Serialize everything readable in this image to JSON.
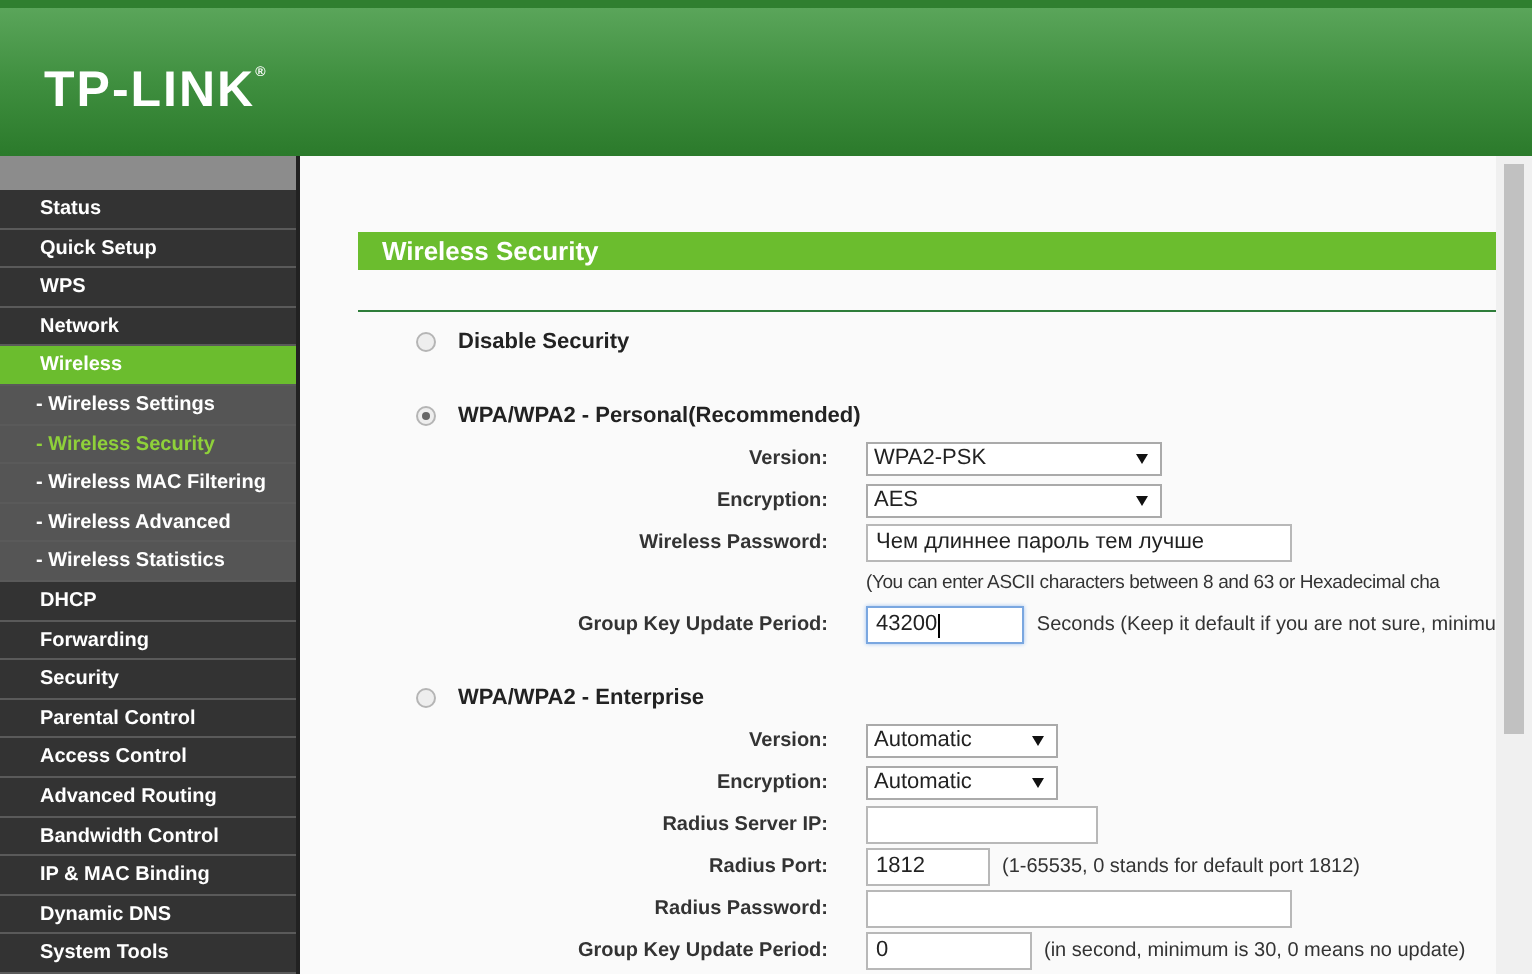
{
  "header": {
    "logo": "TP-LINK",
    "logo_mark": "®"
  },
  "sidebar": {
    "items": [
      {
        "label": "Status",
        "selected": false
      },
      {
        "label": "Quick Setup",
        "selected": false
      },
      {
        "label": "WPS",
        "selected": false
      },
      {
        "label": "Network",
        "selected": false
      },
      {
        "label": "Wireless",
        "selected": true,
        "children": [
          {
            "label": "- Wireless Settings",
            "selected": false
          },
          {
            "label": "- Wireless Security",
            "selected": true
          },
          {
            "label": "- Wireless MAC Filtering",
            "selected": false
          },
          {
            "label": "- Wireless Advanced",
            "selected": false
          },
          {
            "label": "- Wireless Statistics",
            "selected": false
          }
        ]
      },
      {
        "label": "DHCP",
        "selected": false
      },
      {
        "label": "Forwarding",
        "selected": false
      },
      {
        "label": "Security",
        "selected": false
      },
      {
        "label": "Parental Control",
        "selected": false
      },
      {
        "label": "Access Control",
        "selected": false
      },
      {
        "label": "Advanced Routing",
        "selected": false
      },
      {
        "label": "Bandwidth Control",
        "selected": false
      },
      {
        "label": "IP & MAC Binding",
        "selected": false
      },
      {
        "label": "Dynamic DNS",
        "selected": false
      },
      {
        "label": "System Tools",
        "selected": false
      }
    ]
  },
  "page_title": "Wireless Security",
  "sections": [
    {
      "label": "Disable Security",
      "selected": false
    },
    {
      "label": "WPA/WPA2 - Personal(Recommended)",
      "selected": true,
      "fields": [
        {
          "kind": "select",
          "label": "Version:",
          "value": "WPA2-PSK"
        },
        {
          "kind": "select",
          "label": "Encryption:",
          "value": "AES"
        },
        {
          "kind": "input",
          "label": "Wireless Password:",
          "value": "Чем длиннее пароль тем лучше",
          "focused": false
        },
        {
          "kind": "hint",
          "text": "(You can enter ASCII characters between 8 and 63 or Hexadecimal cha"
        },
        {
          "kind": "input",
          "label": "Group Key Update Period:",
          "value": "43200",
          "focused": true,
          "note": "Seconds (Keep it default if you are not sure, minimu"
        }
      ]
    },
    {
      "label": "WPA/WPA2 - Enterprise",
      "selected": false,
      "fields": [
        {
          "kind": "select",
          "label": "Version:",
          "value": "Automatic"
        },
        {
          "kind": "select",
          "label": "Encryption:",
          "value": "Automatic"
        },
        {
          "kind": "input",
          "label": "Radius Server IP:",
          "focused": false
        },
        {
          "kind": "input",
          "label": "Radius Port:",
          "value": "1812",
          "focused": false,
          "note": "(1-65535, 0 stands for default port 1812)"
        },
        {
          "kind": "input",
          "label": "Radius Password:",
          "focused": false
        },
        {
          "kind": "input",
          "label": "Group Key Update Period:",
          "value": "0",
          "focused": false,
          "note": "(in second, minimum is 30, 0 means no update)"
        }
      ]
    }
  ]
}
